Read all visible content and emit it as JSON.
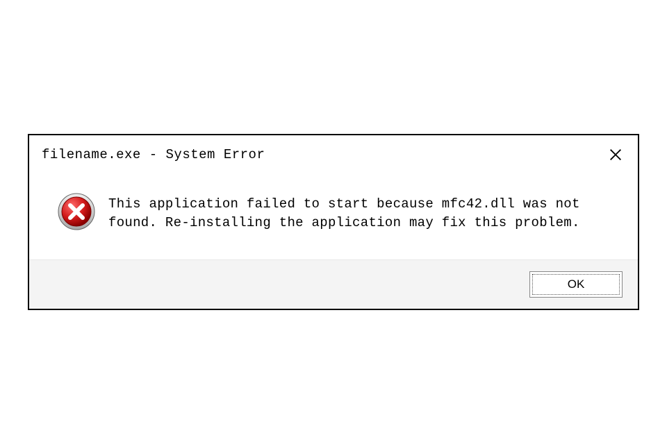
{
  "dialog": {
    "title": "filename.exe - System Error",
    "message": "This application failed to start because mfc42.dll was not found. Re-installing the application may fix this problem.",
    "ok_label": "OK"
  }
}
